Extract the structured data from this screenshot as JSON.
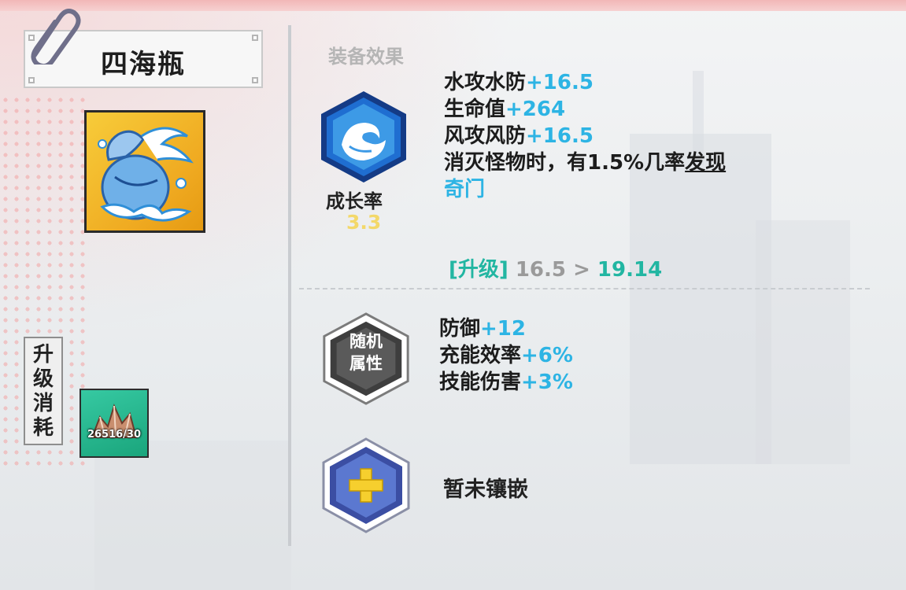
{
  "item": {
    "name": "四海瓶"
  },
  "upgrade_cost": {
    "label_chars": [
      "升",
      "级",
      "消",
      "耗"
    ],
    "material_count": "26516/30"
  },
  "equip_effect": {
    "section_title": "装备效果",
    "growth_label": "成长率",
    "growth_value": "3.3",
    "stats": [
      {
        "name": "水攻水防",
        "value": "+16.5"
      },
      {
        "name": "生命值",
        "value": "+264"
      },
      {
        "name": "风攻风防",
        "value": "+16.5"
      }
    ],
    "special": {
      "text_before": "消灭怪物时，有1.5%几率",
      "underlined": "发现",
      "highlight": "奇门"
    },
    "upgrade": {
      "tag": "[升级]",
      "old_value": "16.5",
      "arrow": ">",
      "new_value": "19.14"
    }
  },
  "random_attributes": {
    "badge_label_line1": "随机",
    "badge_label_line2": "属性",
    "stats": [
      {
        "name": "防御",
        "value": "+12"
      },
      {
        "name": "充能效率",
        "value": "+6%"
      },
      {
        "name": "技能伤害",
        "value": "+3%"
      }
    ]
  },
  "socket": {
    "status": "暂未镶嵌"
  },
  "icons": {
    "clip": "paperclip-icon",
    "item": "vase-water-icon",
    "water_badge": "water-wave-icon",
    "material": "ore-icon",
    "random_badge": "random-attr-badge",
    "socket_badge": "plus-icon"
  },
  "colors": {
    "stat_value": "#2db4e4",
    "upgrade_teal": "#22b6a2",
    "growth_yellow": "#f3d86a",
    "section_grey": "#b5b5b5"
  }
}
